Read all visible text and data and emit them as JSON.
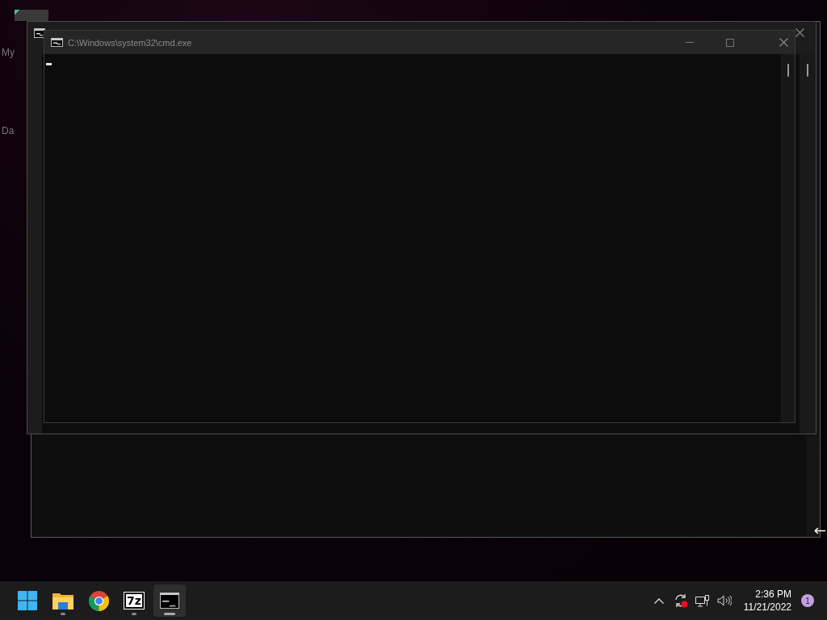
{
  "desktop": {
    "icon_labels": [
      "My",
      "Da"
    ]
  },
  "windows": [
    {
      "kind": "frame"
    },
    {
      "kind": "console",
      "cursor": false
    },
    {
      "kind": "console",
      "title": "C:\\Windows\\system32\\cmd.exe",
      "cursor": true
    }
  ],
  "taskbar": {
    "apps": [
      {
        "kind": "start",
        "running": false,
        "selected": false
      },
      {
        "kind": "explorer",
        "running": true,
        "selected": false
      },
      {
        "kind": "browser",
        "running": false,
        "selected": false
      },
      {
        "kind": "archiver",
        "label": "7z",
        "running": true,
        "selected": false
      },
      {
        "kind": "terminal",
        "running": true,
        "selected": true
      }
    ],
    "tray_icons": [
      {
        "kind": "chevron"
      },
      {
        "kind": "sync"
      },
      {
        "kind": "network"
      },
      {
        "kind": "volume"
      }
    ],
    "time": "2:36 PM",
    "date": "11/21/2022",
    "notification_count": "1"
  }
}
